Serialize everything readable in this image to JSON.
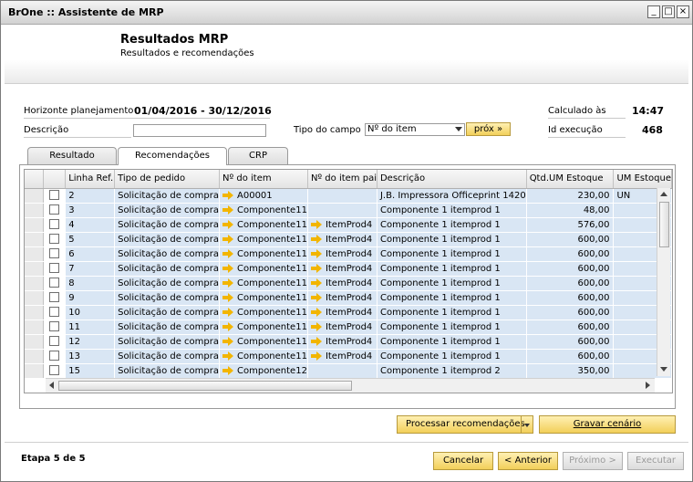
{
  "window": {
    "title": "BrOne :: Assistente de MRP",
    "controls": [
      "_",
      "□",
      "×"
    ]
  },
  "header": {
    "title": "Resultados MRP",
    "subtitle": "Resultados e recomendações"
  },
  "form": {
    "horizonte_label": "Horizonte planejamento",
    "horizonte_value": "01/04/2016  -  30/12/2016",
    "descricao_label": "Descrição",
    "descricao_value": "",
    "tipo_campo_label": "Tipo do campo",
    "tipo_campo_value": "Nº do item",
    "prox_label": "próx »",
    "calculado_label": "Calculado às",
    "calculado_value": "14:47",
    "id_exec_label": "Id execução",
    "id_exec_value": "468"
  },
  "tabs": [
    {
      "label": "Resultado",
      "active": false
    },
    {
      "label": "Recomendações",
      "active": true
    },
    {
      "label": "CRP",
      "active": false
    }
  ],
  "grid": {
    "columns": [
      "",
      "",
      "Linha Ref.",
      "Tipo de pedido",
      "Nº do item",
      "Nº do item pai",
      "Descrição",
      "Qtd.UM Estoque",
      "UM Estoque"
    ],
    "rows": [
      {
        "linha": "2",
        "tipo": "Solicitação de compra",
        "item": "A00001",
        "pai": "",
        "desc": "J.B. Impressora Officeprint 1420",
        "qtd": "230,00",
        "um": "UN"
      },
      {
        "linha": "3",
        "tipo": "Solicitação de compra",
        "item": "Componente11",
        "pai": "",
        "desc": "Componente 1 itemprod 1",
        "qtd": "48,00",
        "um": ""
      },
      {
        "linha": "4",
        "tipo": "Solicitação de compra",
        "item": "Componente11",
        "pai": "ItemProd4",
        "desc": "Componente 1 itemprod 1",
        "qtd": "576,00",
        "um": ""
      },
      {
        "linha": "5",
        "tipo": "Solicitação de compra",
        "item": "Componente11",
        "pai": "ItemProd4",
        "desc": "Componente 1 itemprod 1",
        "qtd": "600,00",
        "um": ""
      },
      {
        "linha": "6",
        "tipo": "Solicitação de compra",
        "item": "Componente11",
        "pai": "ItemProd4",
        "desc": "Componente 1 itemprod 1",
        "qtd": "600,00",
        "um": ""
      },
      {
        "linha": "7",
        "tipo": "Solicitação de compra",
        "item": "Componente11",
        "pai": "ItemProd4",
        "desc": "Componente 1 itemprod 1",
        "qtd": "600,00",
        "um": ""
      },
      {
        "linha": "8",
        "tipo": "Solicitação de compra",
        "item": "Componente11",
        "pai": "ItemProd4",
        "desc": "Componente 1 itemprod 1",
        "qtd": "600,00",
        "um": ""
      },
      {
        "linha": "9",
        "tipo": "Solicitação de compra",
        "item": "Componente11",
        "pai": "ItemProd4",
        "desc": "Componente 1 itemprod 1",
        "qtd": "600,00",
        "um": ""
      },
      {
        "linha": "10",
        "tipo": "Solicitação de compra",
        "item": "Componente11",
        "pai": "ItemProd4",
        "desc": "Componente 1 itemprod 1",
        "qtd": "600,00",
        "um": ""
      },
      {
        "linha": "11",
        "tipo": "Solicitação de compra",
        "item": "Componente11",
        "pai": "ItemProd4",
        "desc": "Componente 1 itemprod 1",
        "qtd": "600,00",
        "um": ""
      },
      {
        "linha": "12",
        "tipo": "Solicitação de compra",
        "item": "Componente11",
        "pai": "ItemProd4",
        "desc": "Componente 1 itemprod 1",
        "qtd": "600,00",
        "um": ""
      },
      {
        "linha": "13",
        "tipo": "Solicitação de compra",
        "item": "Componente11",
        "pai": "ItemProd4",
        "desc": "Componente 1 itemprod 1",
        "qtd": "600,00",
        "um": ""
      },
      {
        "linha": "15",
        "tipo": "Solicitação de compra",
        "item": "Componente12",
        "pai": "",
        "desc": "Componente 1 itemprod 2",
        "qtd": "350,00",
        "um": ""
      }
    ]
  },
  "buttons": {
    "processar": "Processar recomendações",
    "gravar": "Gravar cenário",
    "cancelar": "Cancelar",
    "anterior": "< Anterior",
    "proximo": "Próximo >",
    "executar": "Executar"
  },
  "footer": {
    "etapa": "Etapa 5 de 5"
  },
  "colors": {
    "row_bg": "#d9e6f4",
    "accent_button": "#f2cf5a",
    "link_arrow": "#f2b500"
  }
}
